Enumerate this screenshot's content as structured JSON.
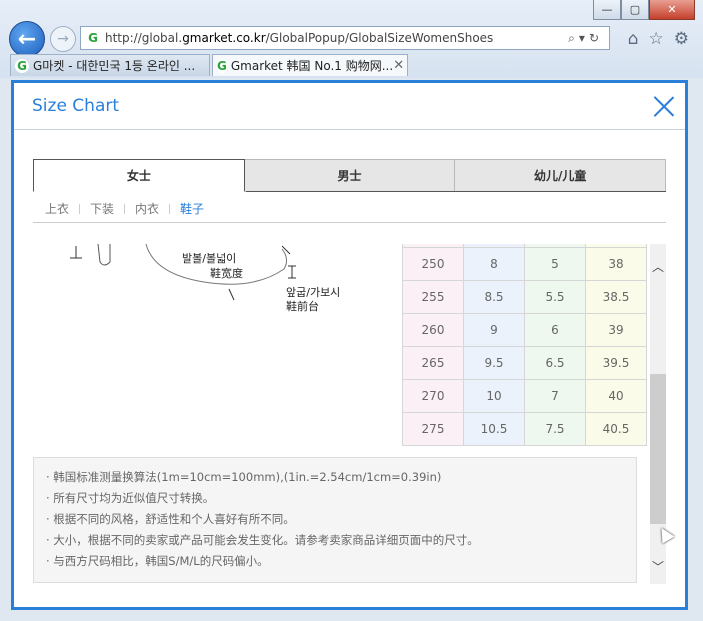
{
  "browser": {
    "url_prefix": "http://global.",
    "url_domain": "gmarket.co.kr",
    "url_path": "/GlobalPopup/GlobalSizeWomenShoes",
    "tabs": [
      {
        "label": "G마켓 - 대한민국 1등 온라인 ..."
      },
      {
        "label": "Gmarket 韩国 No.1 购物网..."
      }
    ]
  },
  "popup": {
    "title": "Size Chart",
    "category_tabs": [
      "女士",
      "男士",
      "幼儿/儿童"
    ],
    "sub_tabs": [
      "上衣",
      "下装",
      "内衣",
      "鞋子"
    ],
    "illustration_labels": {
      "ball_width_kr": "발볼/볼넓이",
      "ball_width_cn": "鞋宽度",
      "front_kr": "앞굽/가보시",
      "front_cn": "鞋前台"
    },
    "size_rows": [
      [
        "250",
        "8",
        "5",
        "38"
      ],
      [
        "255",
        "8.5",
        "5.5",
        "38.5"
      ],
      [
        "260",
        "9",
        "6",
        "39"
      ],
      [
        "265",
        "9.5",
        "6.5",
        "39.5"
      ],
      [
        "270",
        "10",
        "7",
        "40"
      ],
      [
        "275",
        "10.5",
        "7.5",
        "40.5"
      ]
    ],
    "notes": [
      "· 韩国标准测量换算法(1m=10cm=100mm),(1in.=2.54cm/1cm=0.39in)",
      "· 所有尺寸均为近似值尺寸转换。",
      "· 根据不同的风格，舒适性和个人喜好有所不同。",
      "· 大小，根据不同的卖家或产品可能会发生变化。请参考卖家商品详细页面中的尺寸。",
      "· 与西方尺码相比，韩国S/M/L的尺码偏小。"
    ]
  },
  "colors": {
    "accent": "#2a7fd8",
    "tab_bg": "#e6e6e6"
  },
  "icons": [
    "back-icon",
    "forward-icon",
    "gmarket-icon",
    "search-icon",
    "refresh-icon",
    "home-icon",
    "star-icon",
    "gear-icon",
    "close-icon",
    "chevron-up-icon",
    "chevron-down-icon"
  ]
}
